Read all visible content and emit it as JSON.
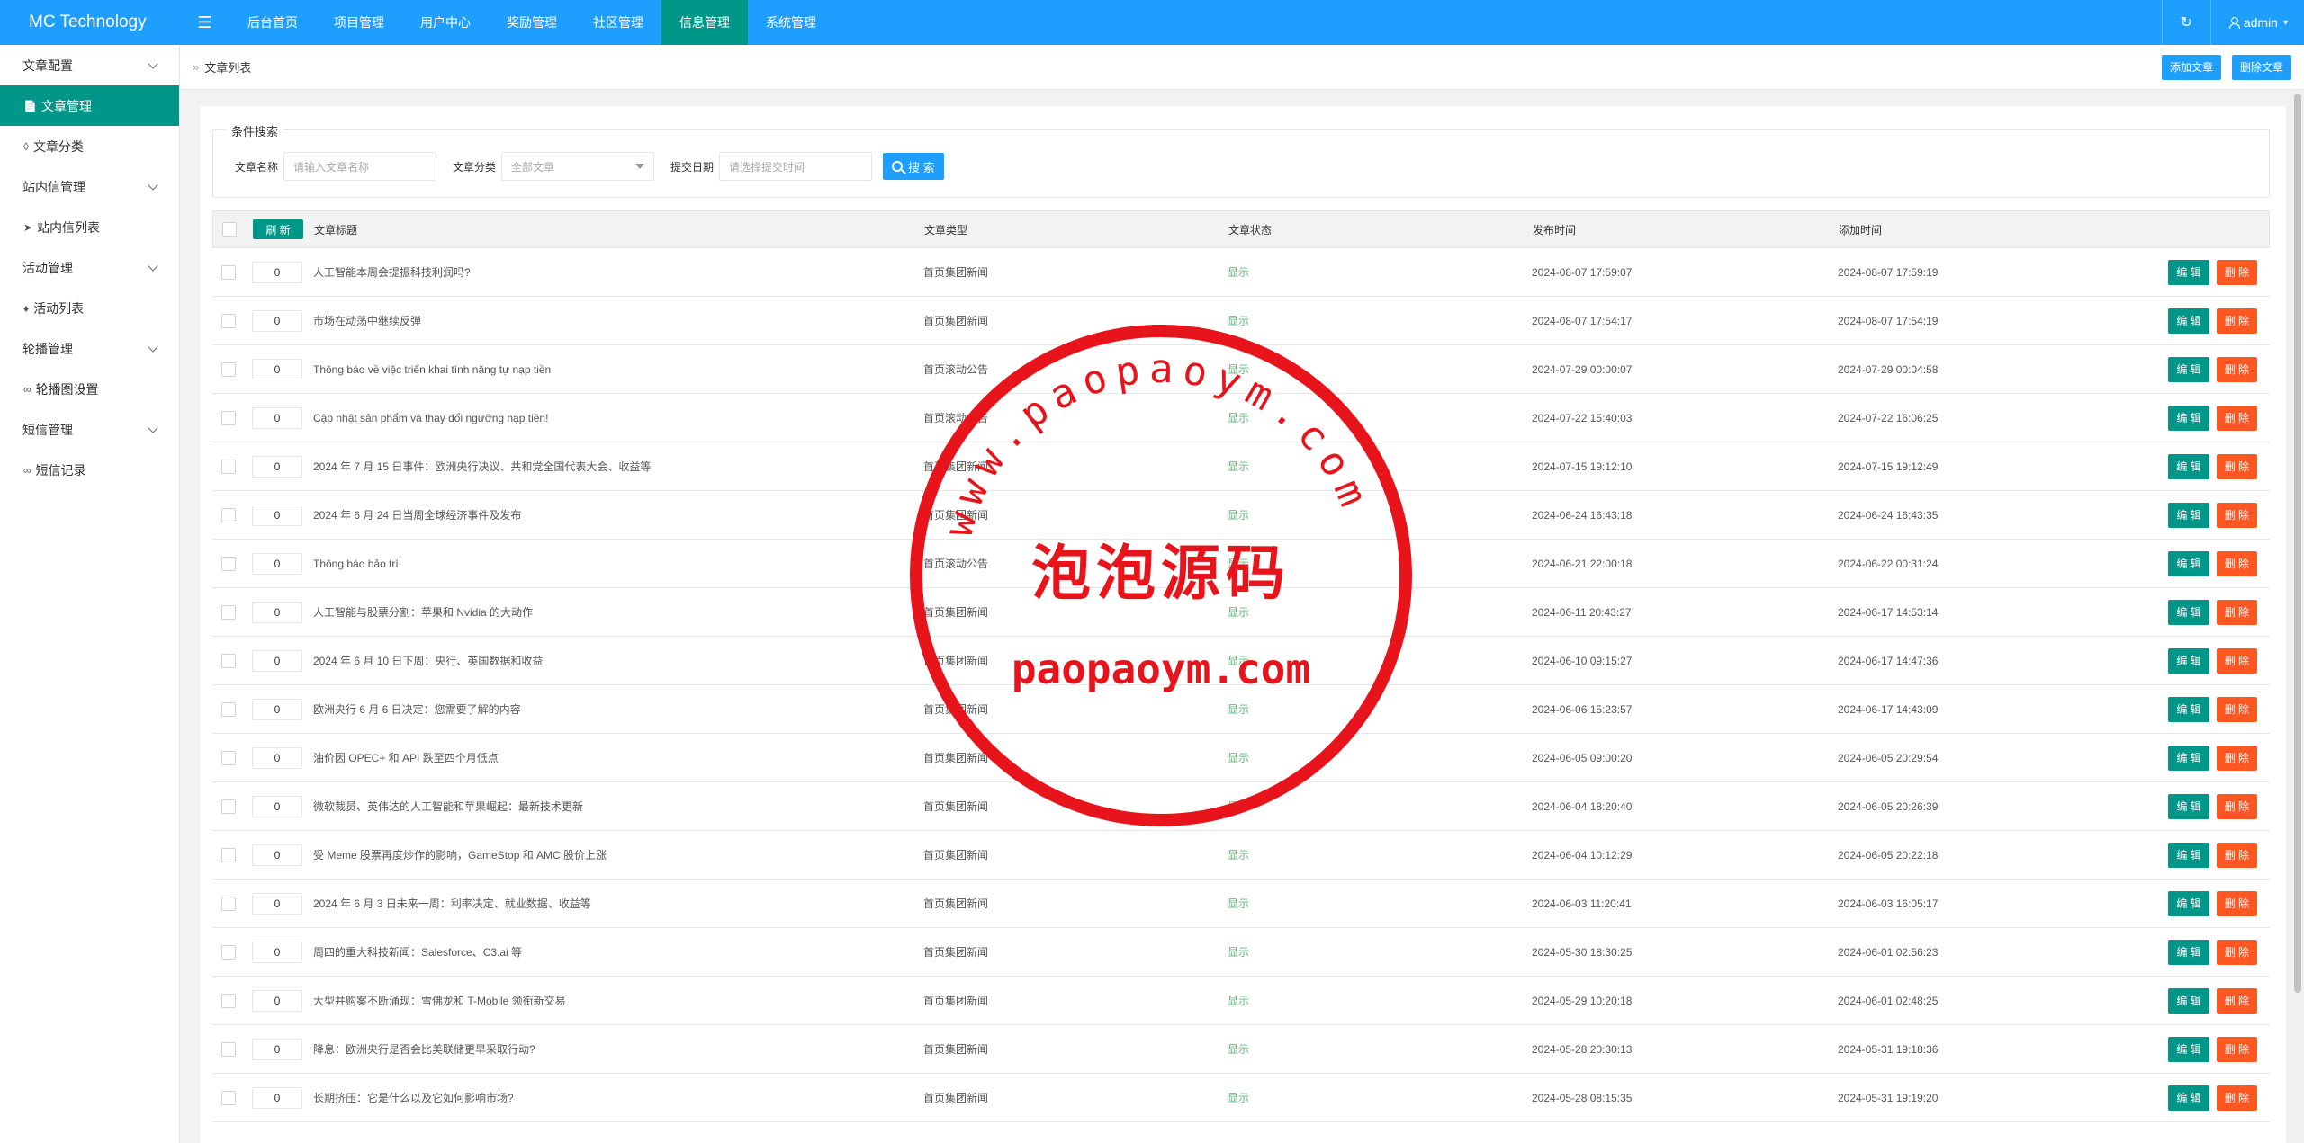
{
  "app": {
    "brand": "MC Technology",
    "user": "admin"
  },
  "nav": [
    "后台首页",
    "项目管理",
    "用户中心",
    "奖励管理",
    "社区管理",
    "信息管理",
    "系统管理"
  ],
  "sidebar": {
    "items": [
      {
        "type": "group",
        "label": "文章配置"
      },
      {
        "type": "sub",
        "label": "文章管理",
        "active": true,
        "icon": "doc-icon"
      },
      {
        "type": "sub",
        "label": "文章分类",
        "icon": "tag-icon"
      },
      {
        "type": "group",
        "label": "站内信管理"
      },
      {
        "type": "sub",
        "label": "站内信列表",
        "icon": "send-icon"
      },
      {
        "type": "group",
        "label": "活动管理"
      },
      {
        "type": "sub",
        "label": "活动列表",
        "icon": "gift-icon"
      },
      {
        "type": "group",
        "label": "轮播管理"
      },
      {
        "type": "sub",
        "label": "轮播图设置",
        "icon": "link-icon"
      },
      {
        "type": "group",
        "label": "短信管理"
      },
      {
        "type": "sub",
        "label": "短信记录",
        "icon": "link-icon"
      }
    ]
  },
  "breadcrumb": "文章列表",
  "header_buttons": {
    "add": "添加文章",
    "delete": "删除文章"
  },
  "search": {
    "legend": "条件搜索",
    "name_label": "文章名称",
    "name_placeholder": "请输入文章名称",
    "category_label": "文章分类",
    "category_value": "全部文章",
    "date_label": "提交日期",
    "date_placeholder": "请选择提交时间",
    "button": "搜 索"
  },
  "table": {
    "refresh_button": "刷 新",
    "columns": [
      "文章标题",
      "文章类型",
      "文章状态",
      "发布时间",
      "添加时间"
    ],
    "edit_label": "编 辑",
    "delete_label": "删 除",
    "rows": [
      {
        "sort": "0",
        "title": "人工智能本周会提振科技利润吗?",
        "type": "首页集团新闻",
        "status": "显示",
        "published": "2024-08-07 17:59:07",
        "added": "2024-08-07 17:59:19"
      },
      {
        "sort": "0",
        "title": "市场在动荡中继续反弹",
        "type": "首页集团新闻",
        "status": "显示",
        "published": "2024-08-07 17:54:17",
        "added": "2024-08-07 17:54:19"
      },
      {
        "sort": "0",
        "title": "Thông báo về việc triển khai tính năng tự nạp tiền",
        "type": "首页滚动公告",
        "status": "显示",
        "published": "2024-07-29 00:00:07",
        "added": "2024-07-29 00:04:58"
      },
      {
        "sort": "0",
        "title": "Cập nhật sản phẩm và thay đổi ngưỡng nạp tiền!",
        "type": "首页滚动公告",
        "status": "显示",
        "published": "2024-07-22 15:40:03",
        "added": "2024-07-22 16:06:25"
      },
      {
        "sort": "0",
        "title": "2024 年 7 月 15 日事件：欧洲央行决议、共和党全国代表大会、收益等",
        "type": "首页集团新闻",
        "status": "显示",
        "published": "2024-07-15 19:12:10",
        "added": "2024-07-15 19:12:49"
      },
      {
        "sort": "0",
        "title": "2024 年 6 月 24 日当周全球经济事件及发布",
        "type": "首页集团新闻",
        "status": "显示",
        "published": "2024-06-24 16:43:18",
        "added": "2024-06-24 16:43:35"
      },
      {
        "sort": "0",
        "title": "Thông báo bảo trì!",
        "type": "首页滚动公告",
        "status": "显示",
        "published": "2024-06-21 22:00:18",
        "added": "2024-06-22 00:31:24"
      },
      {
        "sort": "0",
        "title": "人工智能与股票分割：苹果和 Nvidia 的大动作",
        "type": "首页集团新闻",
        "status": "显示",
        "published": "2024-06-11 20:43:27",
        "added": "2024-06-17 14:53:14"
      },
      {
        "sort": "0",
        "title": "2024 年 6 月 10 日下周：央行、英国数据和收益",
        "type": "首页集团新闻",
        "status": "显示",
        "published": "2024-06-10 09:15:27",
        "added": "2024-06-17 14:47:36"
      },
      {
        "sort": "0",
        "title": "欧洲央行 6 月 6 日决定：您需要了解的内容",
        "type": "首页集团新闻",
        "status": "显示",
        "published": "2024-06-06 15:23:57",
        "added": "2024-06-17 14:43:09"
      },
      {
        "sort": "0",
        "title": "油价因 OPEC+ 和 API 跌至四个月低点",
        "type": "首页集团新闻",
        "status": "显示",
        "published": "2024-06-05 09:00:20",
        "added": "2024-06-05 20:29:54"
      },
      {
        "sort": "0",
        "title": "微软裁员、英伟达的人工智能和苹果崛起：最新技术更新",
        "type": "首页集团新闻",
        "status": "显示",
        "published": "2024-06-04 18:20:40",
        "added": "2024-06-05 20:26:39"
      },
      {
        "sort": "0",
        "title": "受 Meme 股票再度炒作的影响，GameStop 和 AMC 股价上涨",
        "type": "首页集团新闻",
        "status": "显示",
        "published": "2024-06-04 10:12:29",
        "added": "2024-06-05 20:22:18"
      },
      {
        "sort": "0",
        "title": "2024 年 6 月 3 日未来一周：利率决定、就业数据、收益等",
        "type": "首页集团新闻",
        "status": "显示",
        "published": "2024-06-03 11:20:41",
        "added": "2024-06-03 16:05:17"
      },
      {
        "sort": "0",
        "title": "周四的重大科技新闻：Salesforce、C3.ai 等",
        "type": "首页集团新闻",
        "status": "显示",
        "published": "2024-05-30 18:30:25",
        "added": "2024-06-01 02:56:23"
      },
      {
        "sort": "0",
        "title": "大型并购案不断涌现：雪佛龙和 T-Mobile 领衔新交易",
        "type": "首页集团新闻",
        "status": "显示",
        "published": "2024-05-29 10:20:18",
        "added": "2024-06-01 02:48:25"
      },
      {
        "sort": "0",
        "title": "降息：欧洲央行是否会比美联储更早采取行动?",
        "type": "首页集团新闻",
        "status": "显示",
        "published": "2024-05-28 20:30:13",
        "added": "2024-05-31 19:18:36"
      },
      {
        "sort": "0",
        "title": "长期挤压：它是什么以及它如何影响市场?",
        "type": "首页集团新闻",
        "status": "显示",
        "published": "2024-05-28 08:15:35",
        "added": "2024-05-31 19:19:20"
      }
    ]
  },
  "watermark": {
    "ring_text": "www.paopaoym.com",
    "center_text": "泡泡源码",
    "bottom_text": "paopaoym.com",
    "color": "#e8141b"
  },
  "colors": {
    "primary": "#1e9fff",
    "green": "#009688",
    "danger": "#ff5722",
    "status_green": "#5fb878"
  }
}
